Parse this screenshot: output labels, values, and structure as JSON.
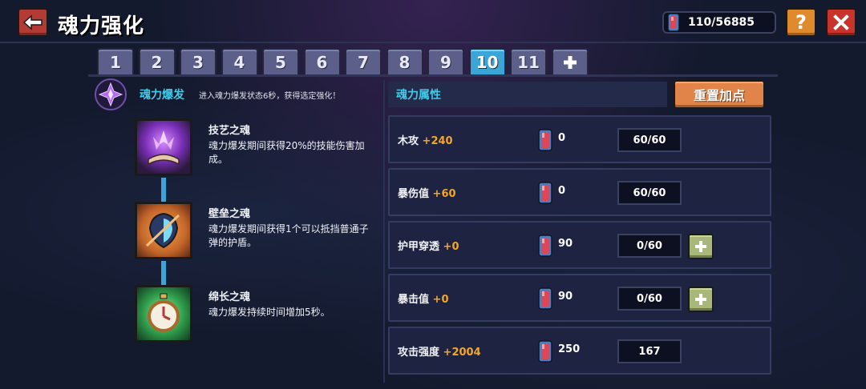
{
  "header": {
    "title": "魂力强化",
    "currency": "110/56885"
  },
  "tabs": [
    "1",
    "2",
    "3",
    "4",
    "5",
    "6",
    "7",
    "8",
    "9",
    "10",
    "11"
  ],
  "active_tab": "10",
  "burst": {
    "title": "魂力爆发",
    "description": "进入魂力爆发状态6秒，获得选定强化！"
  },
  "skills": [
    {
      "name": "技艺之魂",
      "description": "魂力爆发期间获得20%的技能伤害加成。"
    },
    {
      "name": "壁垒之魂",
      "description": "魂力爆发期间获得1个可以抵挡普通子弹的护盾。"
    },
    {
      "name": "绵长之魂",
      "description": "魂力爆发持续时间增加5秒。"
    }
  ],
  "attributes_panel": {
    "title": "魂力属性",
    "reset_label": "重置加点"
  },
  "attributes": [
    {
      "name": "木攻",
      "bonus": "+240",
      "cost": "0",
      "level": "60/60",
      "can_add": false
    },
    {
      "name": "暴伤值",
      "bonus": "+60",
      "cost": "0",
      "level": "60/60",
      "can_add": false
    },
    {
      "name": "护甲穿透",
      "bonus": "+0",
      "cost": "90",
      "level": "0/60",
      "can_add": true
    },
    {
      "name": "暴击值",
      "bonus": "+0",
      "cost": "90",
      "level": "0/60",
      "can_add": true
    },
    {
      "name": "攻击强度",
      "bonus": "+2004",
      "cost": "250",
      "level": "167",
      "can_add": false
    }
  ],
  "colors": {
    "accent_cyan": "#44c9e8",
    "bonus_orange": "#f5a623",
    "active_tab": "#3aa6d8"
  },
  "icons": {
    "back": "back-arrow-icon",
    "help": "help-icon",
    "close": "close-icon",
    "gem": "soul-gem-icon",
    "plus": "plus-icon"
  }
}
